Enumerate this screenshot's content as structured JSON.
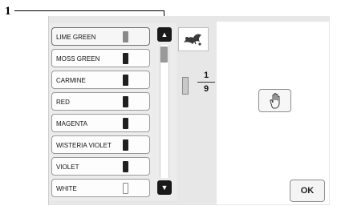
{
  "callout": {
    "number": "1"
  },
  "thread_list": {
    "items": [
      {
        "label": "LIME GREEN",
        "spool": "lime",
        "selected": true
      },
      {
        "label": "MOSS GREEN",
        "spool": "dark"
      },
      {
        "label": "CARMINE",
        "spool": "dark"
      },
      {
        "label": "RED",
        "spool": "dark"
      },
      {
        "label": "MAGENTA",
        "spool": "dark"
      },
      {
        "label": "WISTERIA VIOLET",
        "spool": "dark"
      },
      {
        "label": "VIOLET",
        "spool": "dark"
      },
      {
        "label": "WHITE",
        "spool": "white"
      }
    ]
  },
  "scroll": {
    "up_icon": "triangle-up-icon",
    "down_icon": "triangle-down-icon"
  },
  "counter": {
    "current": "1",
    "total": "9"
  },
  "buttons": {
    "ok_label": "OK",
    "hand_icon": "hand-icon"
  }
}
